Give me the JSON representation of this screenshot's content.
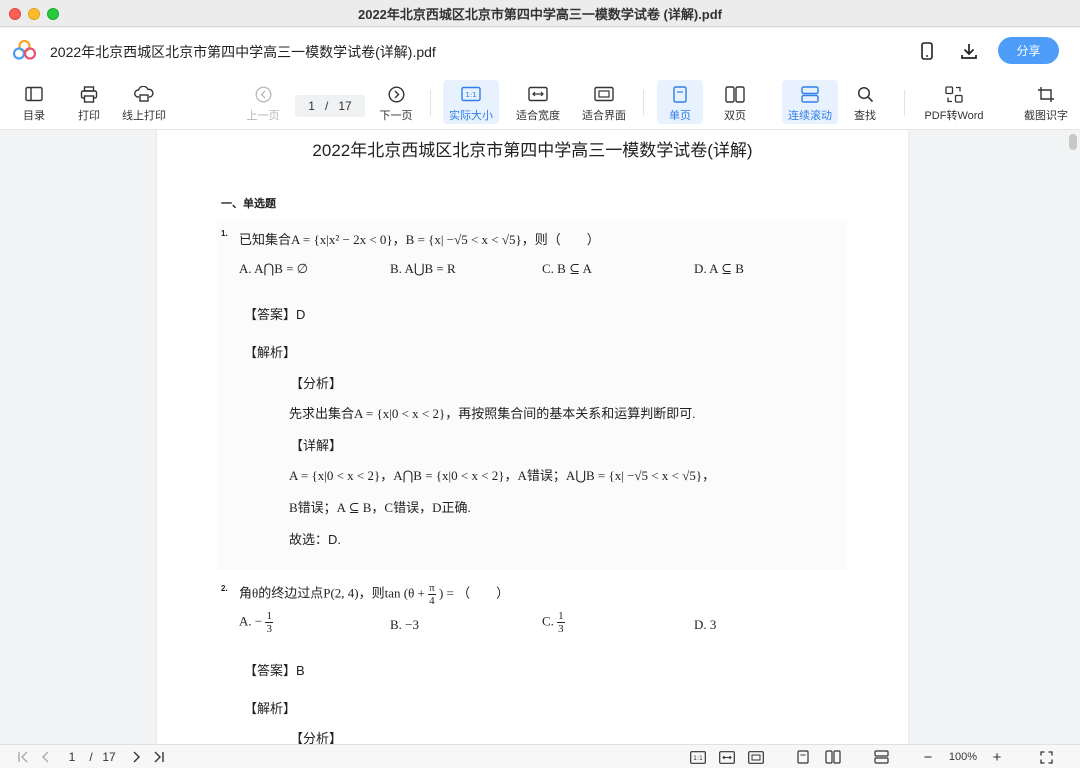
{
  "window": {
    "title": "2022年北京西城区北京市第四中学高三一模数学试卷 (详解).pdf"
  },
  "header": {
    "doc_title": "2022年北京西城区北京市第四中学高三一模数学试卷(详解).pdf",
    "share_label": "分享",
    "icons": [
      "phone-icon",
      "download-icon"
    ]
  },
  "toolbar": {
    "toc": "目录",
    "print": "打印",
    "online_print": "线上打印",
    "prev_page": "上一页",
    "page_current": "1",
    "page_sep": "/",
    "page_total": "17",
    "next_page": "下一页",
    "actual_size": "实际大小",
    "fit_width": "适合宽度",
    "fit_page": "适合界面",
    "single_page": "单页",
    "double_page": "双页",
    "continuous": "连续滚动",
    "find": "查找",
    "pdf_to_word": "PDF转Word",
    "ocr": "截图识字",
    "actual_size_glyph": "1:1"
  },
  "document": {
    "title": "2022年北京西城区北京市第四中学高三一模数学试卷(详解)",
    "section": "一、单选题",
    "q1": {
      "num": "1.",
      "stem": "已知集合A = {x|x² − 2x < 0}，B = {x| −√5 < x < √5}，则（　　）",
      "options": [
        "A. A⋂B = ∅",
        "B. A⋃B = R",
        "C. B ⊆ A",
        "D. A ⊆ B"
      ],
      "answer": "【答案】D",
      "analysis_head": "【解析】",
      "fenxi": "【分析】",
      "fenxi_text": "先求出集合A = {x|0 < x < 2}，再按照集合间的基本关系和运算判断即可.",
      "detail_head": "【详解】",
      "detail_line1": "A = {x|0 < x < 2}，A⋂B = {x|0 < x < 2}，A错误；A⋃B = {x| −√5 < x < √5}，",
      "detail_line2": "B错误；A ⊆ B，C错误，D正确.",
      "conclusion": "故选：D."
    },
    "q2": {
      "num": "2.",
      "stem_prefix": "角θ的终边过点P(2, 4)，则tan (θ +",
      "stem_frac_n": "π",
      "stem_frac_d": "4",
      "stem_suffix": ") = （　　）",
      "optA_prefix": "A. −",
      "optA_n": "1",
      "optA_d": "3",
      "optB": "B. −3",
      "optC_prefix": "C.",
      "optC_n": "1",
      "optC_d": "3",
      "optD": "D. 3",
      "answer": "【答案】B",
      "analysis_head": "【解析】",
      "fenxi": "【分析】"
    }
  },
  "statusbar": {
    "page_current": "1",
    "page_sep": "/",
    "page_total": "17",
    "zoom_out": "−",
    "zoom": "100%",
    "zoom_in": "+"
  },
  "colors": {
    "accent": "#4c9cf8",
    "active_bg": "#e8f1fe",
    "active_text": "#2f7fe8"
  }
}
